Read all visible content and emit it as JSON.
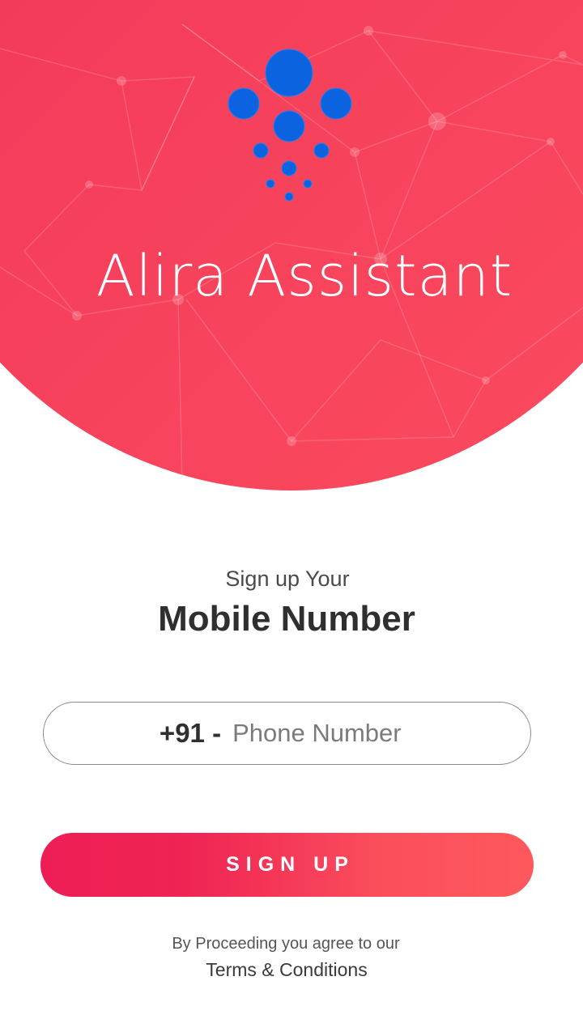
{
  "app": {
    "title": "Alira Assistant",
    "logo_icon": "dots-logo-icon"
  },
  "signup": {
    "subtitle": "Sign up Your",
    "heading": "Mobile Number",
    "country_code": "+91 -",
    "phone_placeholder": "Phone Number",
    "phone_value": "",
    "button_label": "SIGN UP"
  },
  "legal": {
    "notice": "By Proceeding you agree  to our",
    "terms_link": "Terms & Conditions"
  },
  "colors": {
    "hero_start": "#f2305a",
    "hero_end": "#fb4c5e",
    "button_start": "#ee1d56",
    "button_end": "#fe585c",
    "logo_blue": "#0b63e0",
    "text_dark": "#2f2f2f"
  }
}
